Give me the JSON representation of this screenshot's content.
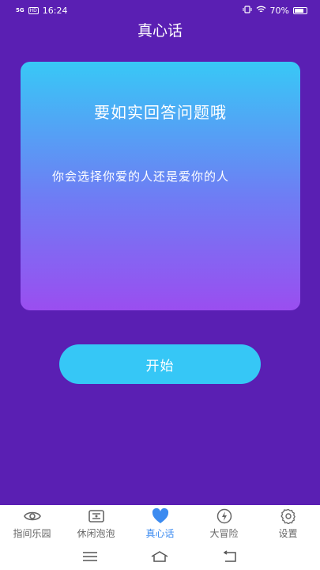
{
  "status_bar": {
    "signal": "5G",
    "hd": "HD",
    "time": "16:24",
    "battery": "70%"
  },
  "app": {
    "title": "真心话"
  },
  "card": {
    "heading": "要如实回答问题哦",
    "question": "你会选择你爱的人还是爱你的人"
  },
  "actions": {
    "start_label": "开始"
  },
  "bottom_nav": {
    "items": [
      {
        "label": "指间乐园",
        "icon": "eye-icon",
        "active": false
      },
      {
        "label": "休闲泡泡",
        "icon": "frame-icon",
        "active": false
      },
      {
        "label": "真心话",
        "icon": "heart-icon",
        "active": true
      },
      {
        "label": "大冒险",
        "icon": "lightning-icon",
        "active": false
      },
      {
        "label": "设置",
        "icon": "gear-icon",
        "active": false
      }
    ]
  },
  "colors": {
    "background": "#5a1fb3",
    "card_top": "#38c8f6",
    "card_bottom": "#9a4ef0",
    "button": "#36c7f6",
    "active_tab": "#3c8bf0"
  }
}
